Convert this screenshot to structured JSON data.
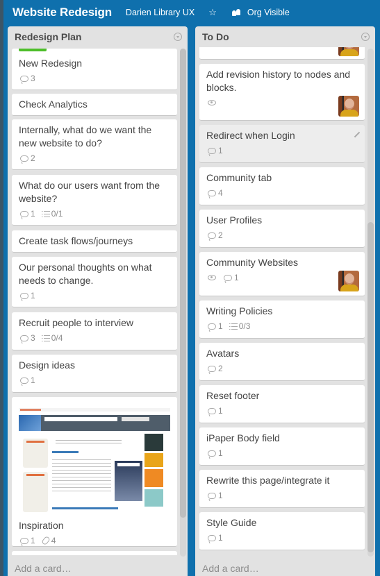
{
  "header": {
    "board_title": "Website Redesign",
    "organization": "Darien Library UX",
    "star_icon": "star-icon",
    "visibility_icon": "org-members-icon",
    "visibility": "Org Visible"
  },
  "colors": {
    "board_background": "#0f70ad",
    "list_background": "#e2e2e2",
    "label_green": "#4ebe2a"
  },
  "lists": [
    {
      "title": "Redesign Plan",
      "add_card": "Add a card…",
      "cards": [
        {
          "title": "New Redesign",
          "label": "green",
          "comments": "3"
        },
        {
          "title": "Check Analytics"
        },
        {
          "title": "Internally, what do we want the new website to do?",
          "comments": "2"
        },
        {
          "title": "What do our users want from the website?",
          "comments": "1",
          "checklist": "0/1"
        },
        {
          "title": "Create task flows/journeys"
        },
        {
          "title": "Our personal thoughts on what needs to change.",
          "comments": "1"
        },
        {
          "title": "Recruit people to interview",
          "comments": "3",
          "checklist": "0/4"
        },
        {
          "title": "Design ideas",
          "comments": "1"
        },
        {
          "title": "Inspiration",
          "cover": "Darien Library website screenshot",
          "comments": "1",
          "attachments": "4"
        }
      ]
    },
    {
      "title": "To Do",
      "add_card": "Add a card…",
      "cards": [
        {
          "title": "",
          "member": "avatar"
        },
        {
          "title": "Add revision history to nodes and blocks.",
          "watching": true,
          "member": "avatar"
        },
        {
          "title": "Redirect when Login",
          "comments": "1",
          "hovered": true
        },
        {
          "title": "Community tab",
          "comments": "4"
        },
        {
          "title": "User Profiles",
          "comments": "2"
        },
        {
          "title": "Community Websites",
          "watching": true,
          "comments": "1",
          "member": "avatar"
        },
        {
          "title": "Writing Policies",
          "comments": "1",
          "checklist": "0/3"
        },
        {
          "title": "Avatars",
          "comments": "2"
        },
        {
          "title": "Reset footer",
          "comments": "1"
        },
        {
          "title": "iPaper Body field",
          "comments": "1"
        },
        {
          "title": "Rewrite this page/integrate it",
          "comments": "1"
        },
        {
          "title": "Style Guide",
          "comments": "1"
        }
      ]
    }
  ]
}
